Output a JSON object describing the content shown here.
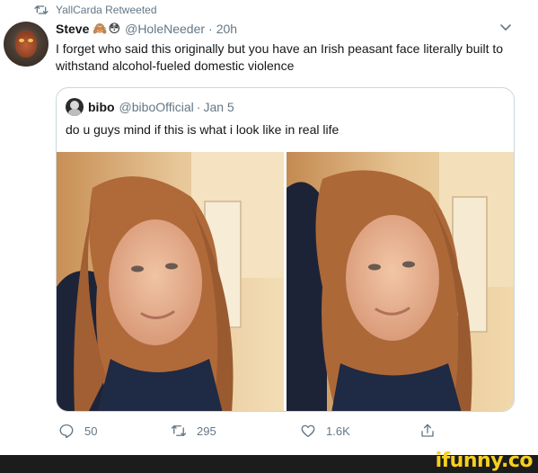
{
  "retweet_context": {
    "icon": "retweet-icon",
    "text": "YallCarda Retweeted"
  },
  "tweet": {
    "author_name": "Steve",
    "author_emojis": [
      "🙈",
      "😳"
    ],
    "handle": "@HoleNeeder",
    "separator": "·",
    "time": "20h",
    "text": "I forget who said this originally but you have an Irish peasant face literally built to withstand alcohol-fueled domestic violence",
    "menu_icon": "chevron-down-icon"
  },
  "quoted_tweet": {
    "author_name": "bibo",
    "handle": "@biboOfficial",
    "separator": "·",
    "date": "Jan 5",
    "text": "do u guys mind if this is what i look like in real life",
    "photos": 2
  },
  "actions": {
    "reply_count": "50",
    "retweet_count": "295",
    "like_count": "1.6K",
    "share_icon": "share-icon"
  },
  "watermark": "ifunny.co",
  "colors": {
    "secondary_text": "#657786",
    "border": "#ccd6dd",
    "watermark": "#f7d020"
  }
}
